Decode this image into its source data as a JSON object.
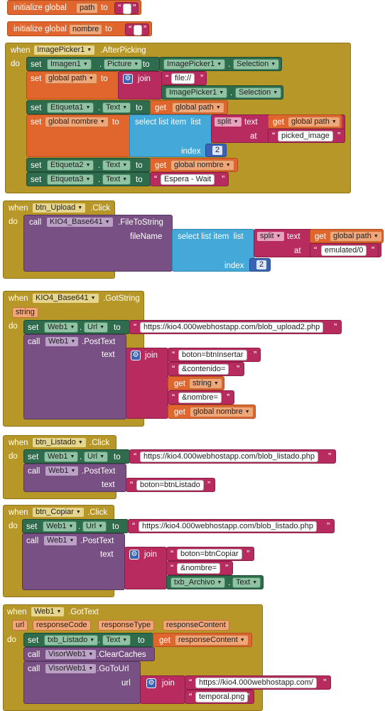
{
  "kw": {
    "init_global": "initialize global",
    "to": "to",
    "when": "when",
    "do": "do",
    "set": "set",
    "get": "get",
    "call": "call",
    "join": "join",
    "select_list_item": "select list item",
    "list": "list",
    "index": "index",
    "text": "text",
    "at": "at",
    "url": "url",
    "fileName": "fileName",
    "dot": "."
  },
  "globals": [
    {
      "name": "path"
    },
    {
      "name": "nombre"
    }
  ],
  "blocks": {
    "picker": {
      "component": "ImagePicker1",
      "event": ".AfterPicking",
      "set1_comp": "Imagen1",
      "set1_prop": "Picture",
      "join_text1": "file://",
      "join_comp": "ImagePicker1",
      "join_prop": "Selection",
      "set2_global": "global path",
      "set3_comp": "Etiqueta1",
      "set3_prop": "Text",
      "set3_get": "global path",
      "set4_global": "global nombre",
      "split": "split",
      "split_get": "global path",
      "split_at": "picked_image",
      "index_value": "2",
      "set5_comp": "Etiqueta2",
      "set5_prop": "Text",
      "set5_get": "global nombre",
      "set6_comp": "Etiqueta3",
      "set6_prop": "Text",
      "set6_text": "Espera - Wait"
    },
    "upload": {
      "component": "btn_Upload",
      "event": ".Click",
      "call_comp": "KIO4_Base641",
      "call_method": ".FileToString",
      "split": "split",
      "split_get": "global path",
      "split_at": "emulated/0",
      "index_value": "2"
    },
    "gotstring": {
      "component": "KIO4_Base641",
      "event": ".GotString",
      "param": "string",
      "set_comp": "Web1",
      "set_prop": "Url",
      "url": "https://kio4.000webhostapp.com/blob_upload2.php",
      "call_comp": "Web1",
      "call_method": ".PostText",
      "j1": "boton=btnInsertar",
      "j2": "&contenido=",
      "j3_get": "string",
      "j4": "&nombre=",
      "j5_get": "global nombre"
    },
    "listado": {
      "component": "btn_Listado",
      "event": ".Click",
      "set_comp": "Web1",
      "set_prop": "Url",
      "url": "https://kio4.000webhostapp.com/blob_listado.php",
      "call_comp": "Web1",
      "call_method": ".PostText",
      "text_value": "boton=btnListado"
    },
    "copiar": {
      "component": "btn_Copiar",
      "event": ".Click",
      "set_comp": "Web1",
      "set_prop": "Url",
      "url": "https://kio4.000webhostapp.com/blob_listado.php",
      "call_comp": "Web1",
      "call_method": ".PostText",
      "j1": "boton=btnCopiar",
      "j2": "&nombre=",
      "j3_comp": "txb_Archivo",
      "j3_prop": "Text"
    },
    "gottext": {
      "component": "Web1",
      "event": ".GotText",
      "params": [
        "url",
        "responseCode",
        "responseType",
        "responseContent"
      ],
      "set_comp": "txb_Listado",
      "set_prop": "Text",
      "set_get": "responseContent",
      "call1_comp": "VisorWeb1",
      "call1_method": ".ClearCaches",
      "call2_comp": "VisorWeb1",
      "call2_method": ".GoToUrl",
      "j1": "https://kio4.000webhostapp.com/",
      "j2": "temporal.png"
    }
  },
  "colors": {
    "variable": "#e0662e",
    "event": "#b79728",
    "component": "#2f6b4d",
    "text": "#b82b5e",
    "procedure": "#795084",
    "list": "#44a8d8",
    "math": "#3b63b5"
  },
  "icons": {
    "dropdown": "dropdown-arrow-icon",
    "mutator": "gear-icon"
  }
}
